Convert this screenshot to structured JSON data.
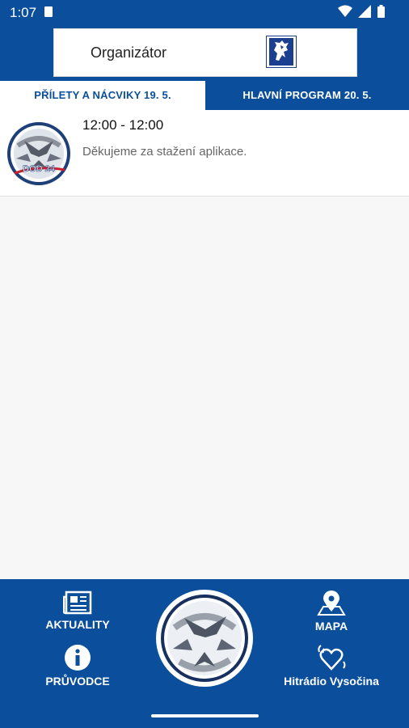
{
  "status": {
    "time": "1:07"
  },
  "header": {
    "organizer_label": "Organizátor"
  },
  "tabs": [
    {
      "label": "PŘÍLETY A NÁCVIKY 19. 5.",
      "active": true
    },
    {
      "label": "HLAVNÍ PROGRAM 20. 5.",
      "active": false
    }
  ],
  "program": [
    {
      "time": "12:00 - 12:00",
      "text": "Děkujeme za stažení aplikace.",
      "logo_text": "DOD 24"
    }
  ],
  "nav": {
    "news": "AKTUALITY",
    "guide": "PRŮVODCE",
    "map": "MAPA",
    "radio": "Hitrádio Vysočina"
  },
  "colors": {
    "brand_blue": "#0b4f9c"
  }
}
